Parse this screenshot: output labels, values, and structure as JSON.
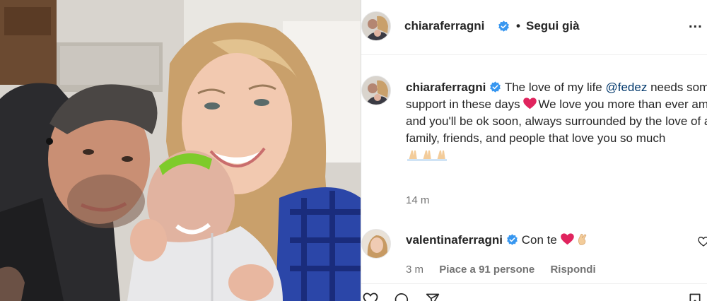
{
  "post": {
    "username": "chiaraferragni",
    "separator": "•",
    "follow_label": "Segui già",
    "more_label": "..."
  },
  "caption": {
    "username": "chiaraferragni",
    "text_part1": "The love of my life ",
    "mention": "@fedez",
    "text_part2": " needs some extra support in these days",
    "text_part3": "We love you more than ever amore mio, and you'll be ok soon, always surrounded by the love of all your family, friends, and people that love you so much",
    "time": "14 m"
  },
  "comment": {
    "username": "valentinaferragni",
    "text": "Con te",
    "time": "3 m",
    "likes": "Piace a 91 persone",
    "reply": "Rispondi"
  },
  "icons": {
    "verified": "verified-badge-icon",
    "heart": "red-heart-emoji",
    "praying_hands": "praying-hands-emoji",
    "fingers_crossed": "crossed-fingers-emoji",
    "like": "heart-outline-icon",
    "more": "more-options-icon"
  },
  "colors": {
    "verified": "#3897f0",
    "text": "#262626",
    "muted": "#737373",
    "mention": "#00376b",
    "heart": "#e0245e"
  }
}
